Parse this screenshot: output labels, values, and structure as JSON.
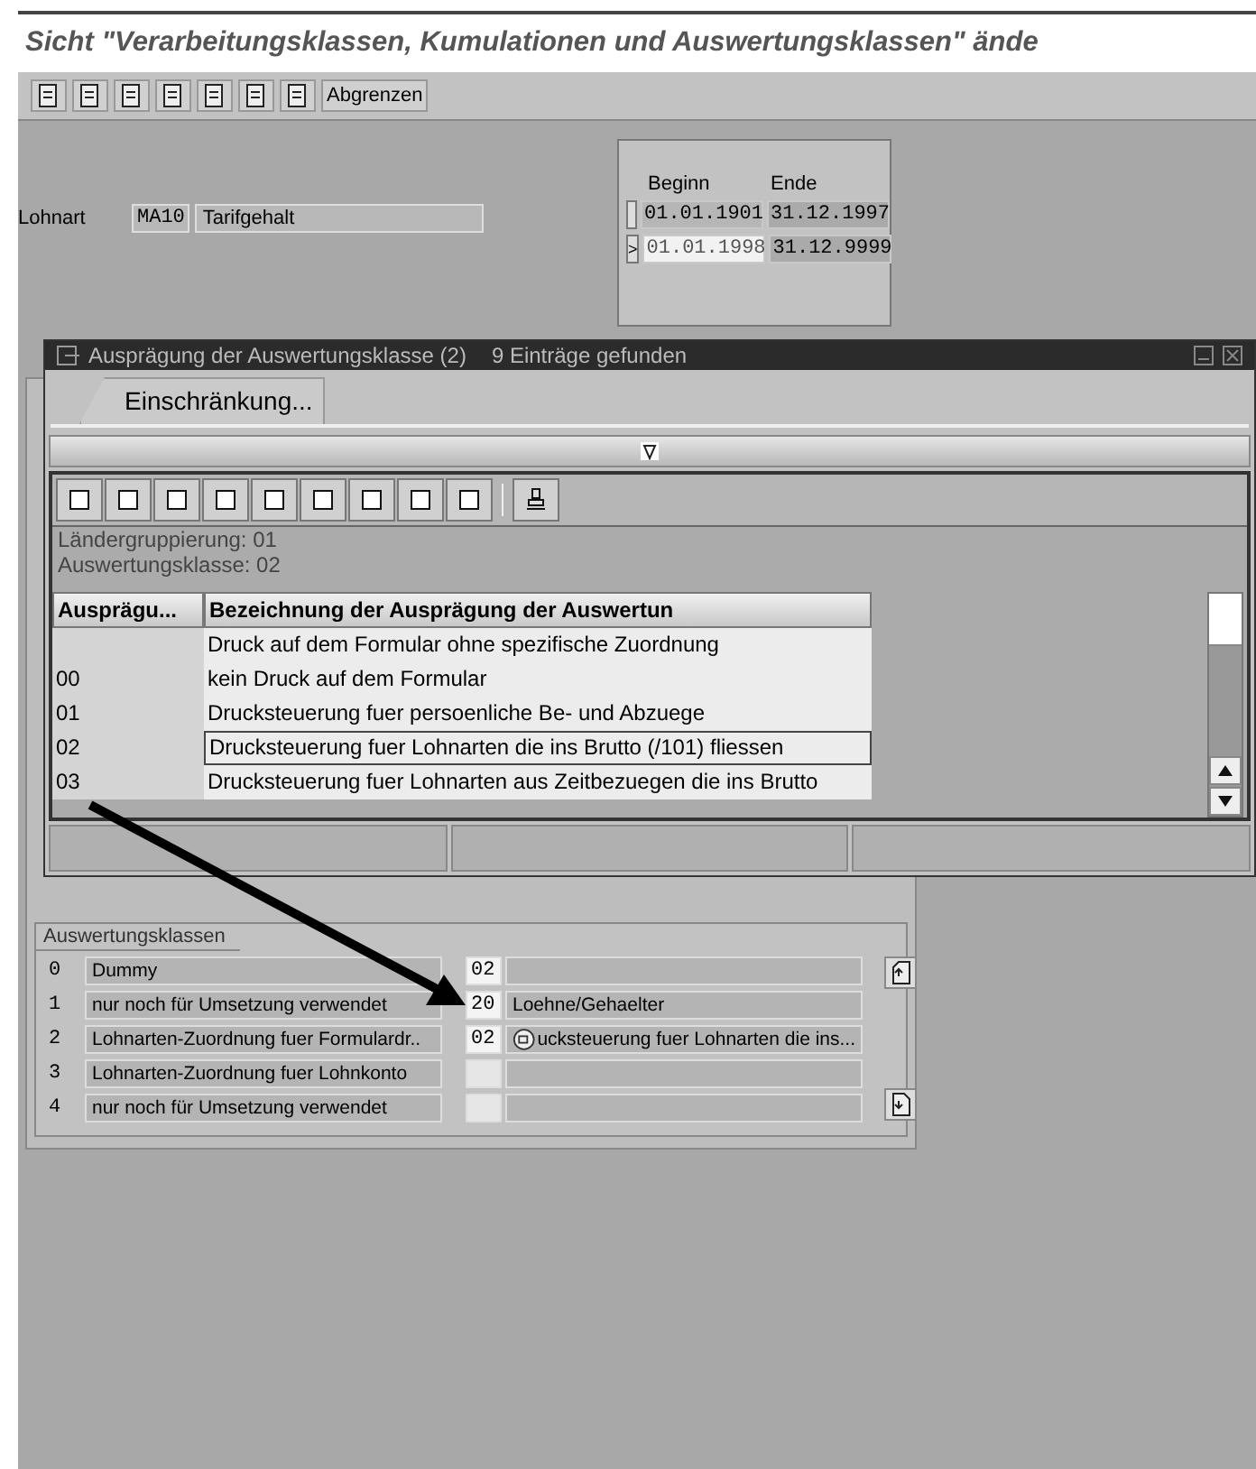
{
  "title": "Sicht \"Verarbeitungsklassen, Kumulationen und Auswertungsklassen\" ände",
  "toolbar": {
    "button": "Abgrenzen"
  },
  "lohnart": {
    "label": "Lohnart",
    "code": "MA10",
    "text": "Tarifgehalt"
  },
  "period": {
    "headers": [
      "Beginn",
      "Ende"
    ],
    "rows": [
      {
        "marker": "",
        "begin": "01.01.1901",
        "end": "31.12.1997",
        "selected": false
      },
      {
        "marker": ">",
        "begin": "01.01.1998",
        "end": "31.12.9999",
        "selected": true
      }
    ]
  },
  "dialog": {
    "title": "Ausprägung der Auswertungsklasse (2)",
    "count": "9 Einträge gefunden",
    "tab": "Einschränkung...",
    "info": [
      "Ländergruppierung: 01",
      "Auswertungsklasse: 02"
    ],
    "columns": [
      "Ausprägu...",
      "Bezeichnung der Ausprägung der Auswertun"
    ],
    "rows": [
      {
        "code": "",
        "text": "Druck auf dem Formular ohne spezifische Zuordnung",
        "selected": false
      },
      {
        "code": "00",
        "text": "kein Druck auf dem Formular",
        "selected": false
      },
      {
        "code": "01",
        "text": "Drucksteuerung fuer persoenliche Be- und Abzuege",
        "selected": false
      },
      {
        "code": "02",
        "text": "Drucksteuerung fuer Lohnarten die ins Brutto (/101) fliessen",
        "selected": true
      },
      {
        "code": "03",
        "text": "Drucksteuerung fuer Lohnarten aus Zeitbezuegen die ins Brutto",
        "selected": false
      }
    ]
  },
  "classes": {
    "title": "Auswertungsklassen",
    "rows": [
      {
        "num": "0",
        "label": "Dummy",
        "value": "02",
        "text": "",
        "help": false
      },
      {
        "num": "1",
        "label": "nur noch für Umsetzung verwendet",
        "value": "20",
        "text": "Loehne/Gehaelter",
        "help": false
      },
      {
        "num": "2",
        "label": "Lohnarten-Zuordnung fuer Formulardr..",
        "value": "02",
        "text": "ucksteuerung fuer Lohnarten die ins...",
        "help": true
      },
      {
        "num": "3",
        "label": "Lohnarten-Zuordnung fuer Lohnkonto",
        "value": "",
        "text": "",
        "help": false
      },
      {
        "num": "4",
        "label": "nur noch für Umsetzung verwendet",
        "value": "",
        "text": "",
        "help": false
      }
    ]
  }
}
